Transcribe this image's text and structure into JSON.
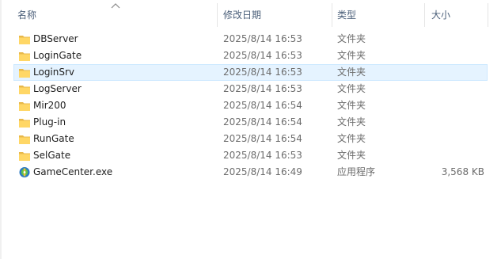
{
  "columns": {
    "name": "名称",
    "date": "修改日期",
    "type": "类型",
    "size": "大小"
  },
  "files": [
    {
      "name": "DBServer",
      "date": "2025/8/14 16:53",
      "type": "文件夹",
      "size": "",
      "icon": "folder-icon",
      "selected": false
    },
    {
      "name": "LoginGate",
      "date": "2025/8/14 16:53",
      "type": "文件夹",
      "size": "",
      "icon": "folder-icon",
      "selected": false
    },
    {
      "name": "LoginSrv",
      "date": "2025/8/14 16:53",
      "type": "文件夹",
      "size": "",
      "icon": "folder-icon",
      "selected": true
    },
    {
      "name": "LogServer",
      "date": "2025/8/14 16:53",
      "type": "文件夹",
      "size": "",
      "icon": "folder-icon",
      "selected": false
    },
    {
      "name": "Mir200",
      "date": "2025/8/14 16:54",
      "type": "文件夹",
      "size": "",
      "icon": "folder-icon",
      "selected": false
    },
    {
      "name": "Plug-in",
      "date": "2025/8/14 16:54",
      "type": "文件夹",
      "size": "",
      "icon": "folder-icon",
      "selected": false
    },
    {
      "name": "RunGate",
      "date": "2025/8/14 16:54",
      "type": "文件夹",
      "size": "",
      "icon": "folder-icon",
      "selected": false
    },
    {
      "name": "SelGate",
      "date": "2025/8/14 16:53",
      "type": "文件夹",
      "size": "",
      "icon": "folder-icon",
      "selected": false
    },
    {
      "name": "GameCenter.exe",
      "date": "2025/8/14 16:49",
      "type": "应用程序",
      "size": "3,568 KB",
      "icon": "app-icon",
      "selected": false
    }
  ],
  "colors": {
    "selected_bg": "#e5f3ff",
    "selected_border": "#cce8ff",
    "folder_yellow": "#ffd766",
    "header_text": "#4c607a"
  }
}
